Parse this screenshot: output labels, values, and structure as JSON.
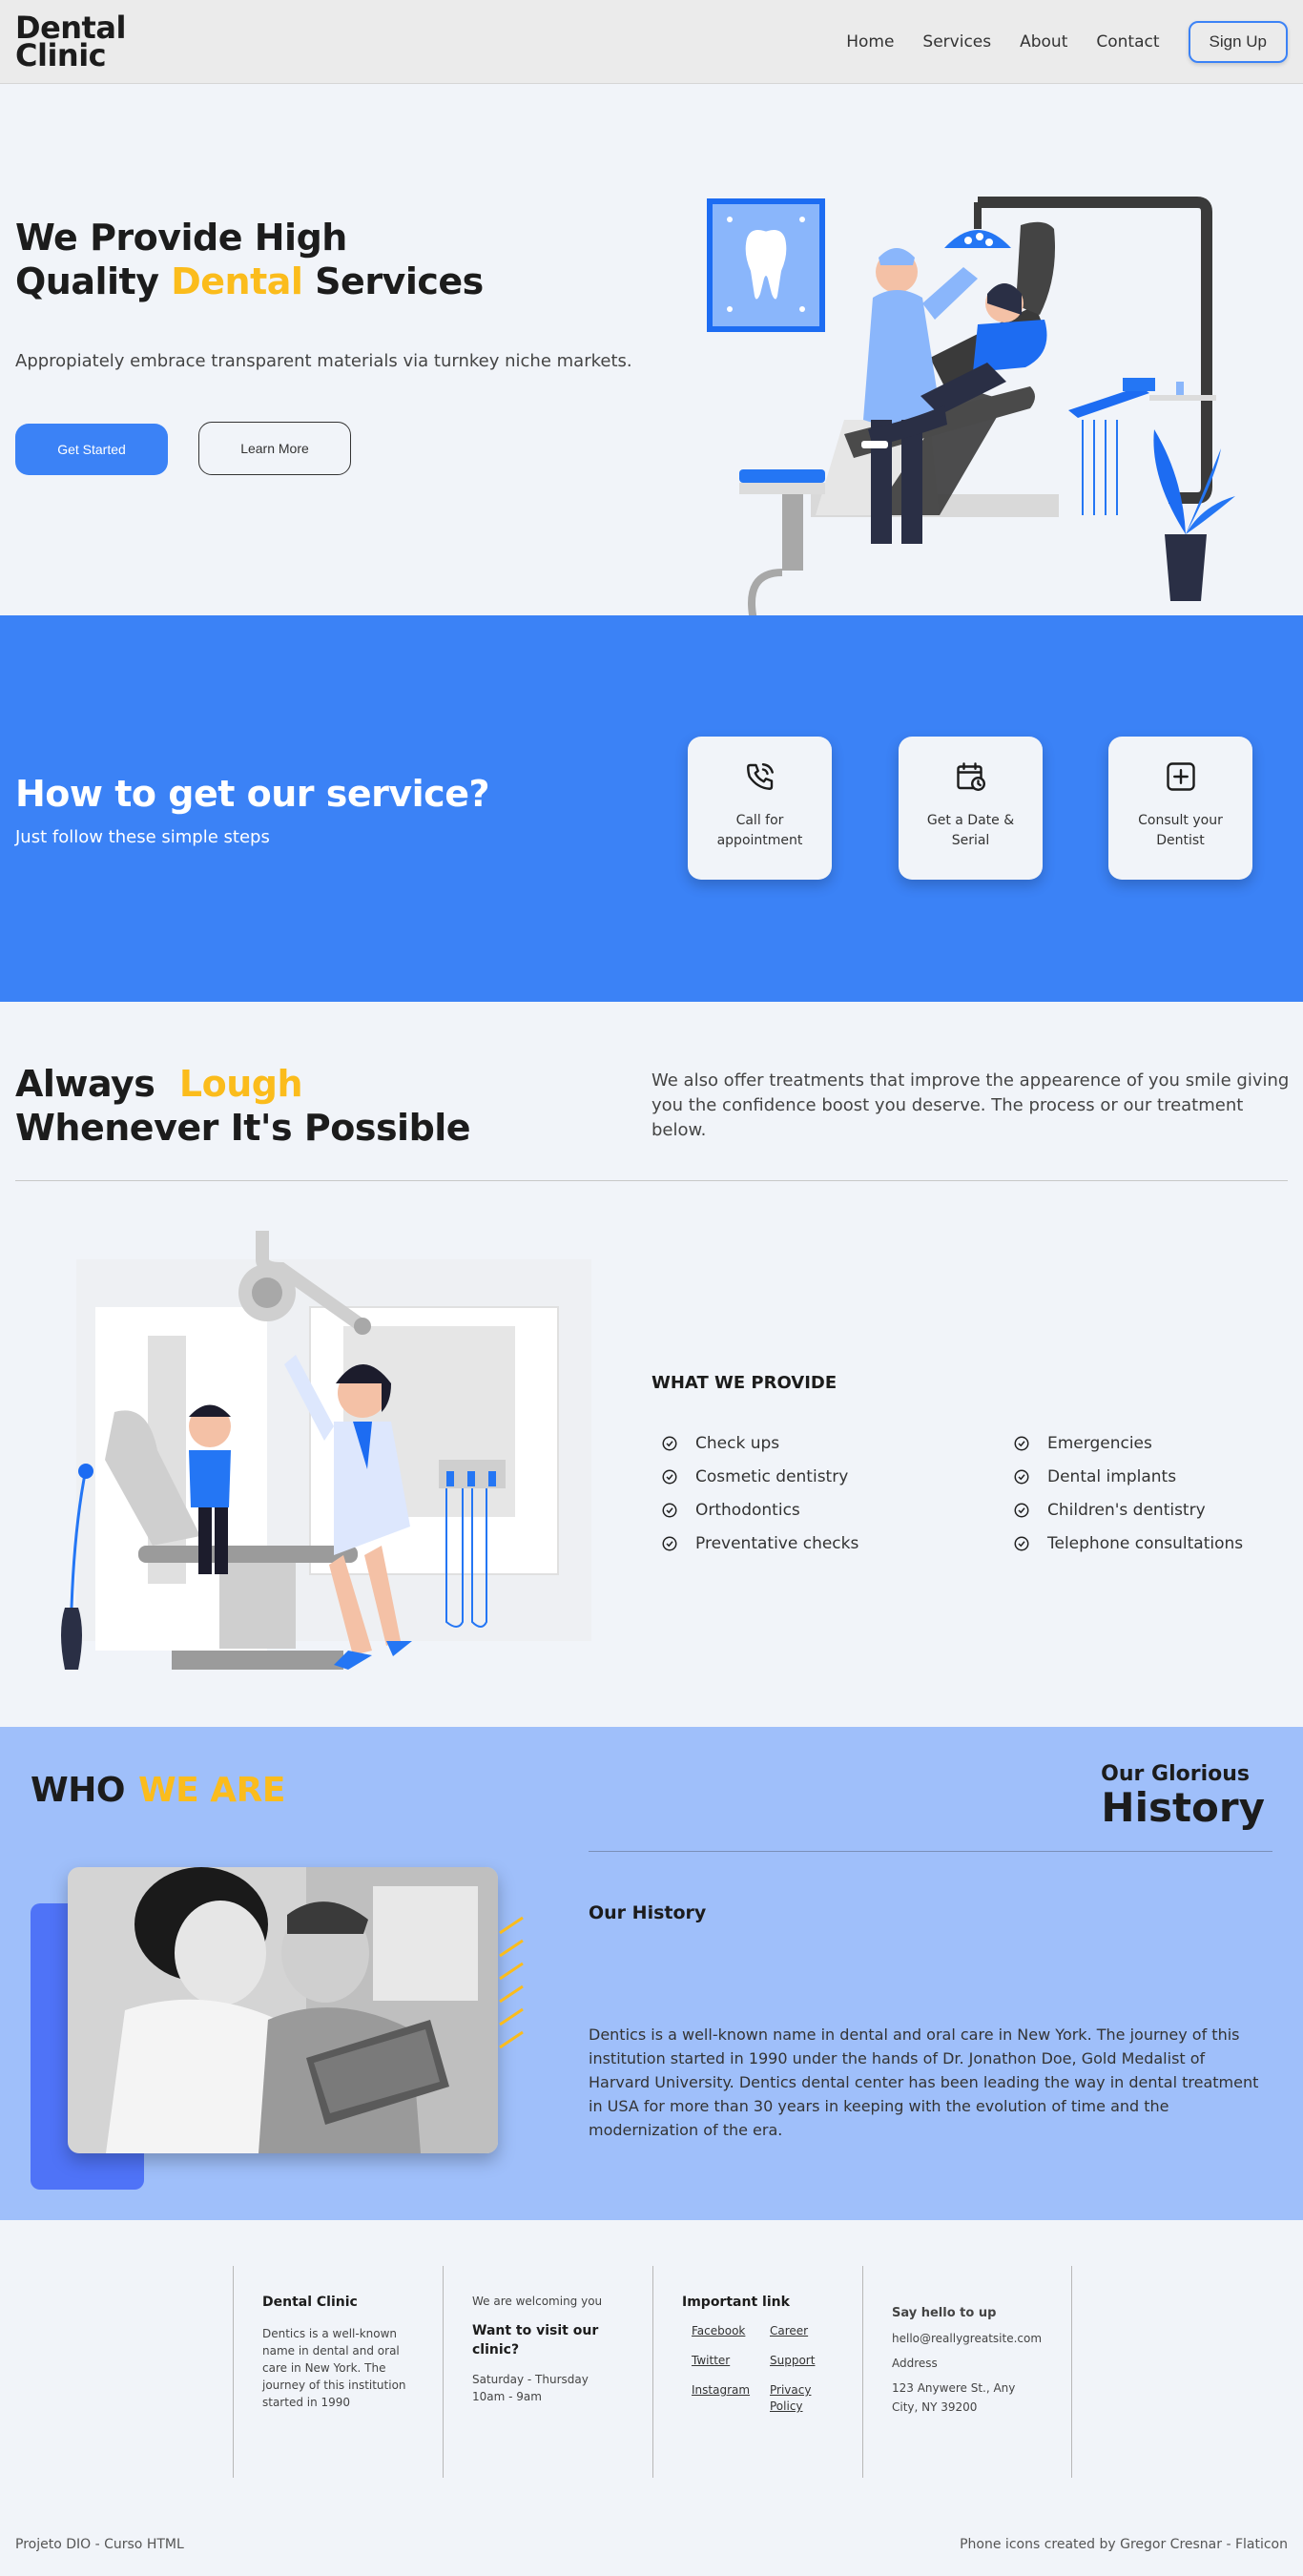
{
  "nav": {
    "logo_line1": "Dental",
    "logo_line2": "Clinic",
    "links": [
      "Home",
      "Services",
      "About",
      "Contact"
    ],
    "signup": "Sign Up"
  },
  "hero": {
    "title_line1": "We Provide High",
    "title_pre": "Quality",
    "title_accent": "Dental",
    "title_post": "Services",
    "subtitle": "Appropiately embrace transparent materials via turnkey niche markets.",
    "btn_primary": "Get Started",
    "btn_secondary": "Learn More"
  },
  "steps": {
    "title": "How to get our service?",
    "subtitle": "Just follow these simple steps",
    "cards": [
      {
        "label": "Call for appointment",
        "icon": "phone-icon"
      },
      {
        "label": "Get a Date & Serial",
        "icon": "calendar-icon"
      },
      {
        "label": "Consult your Dentist",
        "icon": "plus-square-icon"
      }
    ]
  },
  "always": {
    "title_word1": "Always",
    "title_accent": "Lough",
    "title_line2": "Whenever It's Possible",
    "text": "We also offer treatments that improve the appearence of you smile giving you the confidence boost you deserve. The process or our treatment below.",
    "provide_title": "WHAT WE PROVIDE",
    "provide_left": [
      "Check ups",
      "Cosmetic dentistry",
      "Orthodontics",
      "Preventative checks"
    ],
    "provide_right": [
      "Emergencies",
      "Dental implants",
      "Children's dentistry",
      "Telephone consultations"
    ]
  },
  "who": {
    "title_word": "WHO",
    "title_accent": "WE ARE",
    "history_small": "Our Glorious",
    "history_big": "History",
    "our_history": "Our History",
    "text": "Dentics is a well-known name in dental and oral care in New York. The journey of this institution started in 1990 under the hands of Dr. Jonathon Doe, Gold Medalist of Harvard University. Dentics dental center has been leading the way in dental treatment in USA for more than 30 years in keeping with the evolution of time and the modernization of the era."
  },
  "footer": {
    "col1_title": "Dental Clinic",
    "col1_text": "Dentics is a well-known name in dental and oral care in New York. The journey of this institution started in 1990",
    "col2_pre": "We are welcoming you",
    "col2_title": "Want to visit our clinic?",
    "col2_days": "Saturday - Thursday",
    "col2_hours": "10am - 9am",
    "col3_title": "Important link",
    "col3_links": [
      "Facebook",
      "Career",
      "Twitter",
      "Support",
      "Instagram",
      "Privacy Policy"
    ],
    "col4_title": "Say hello to up",
    "col4_email": "hello@reallygreatsite.com",
    "col4_address_label": "Address",
    "col4_address1": "123 Anywere St., Any",
    "col4_address2": "City, NY 39200",
    "credits_left": "Projeto DIO - Curso HTML",
    "credits_right": "Phone icons created by Gregor Cresnar - Flaticon"
  },
  "colors": {
    "primary": "#3b82f6",
    "accent": "#fbbc1c",
    "light_blue": "#9fbffa",
    "background": "#f1f4f9"
  }
}
